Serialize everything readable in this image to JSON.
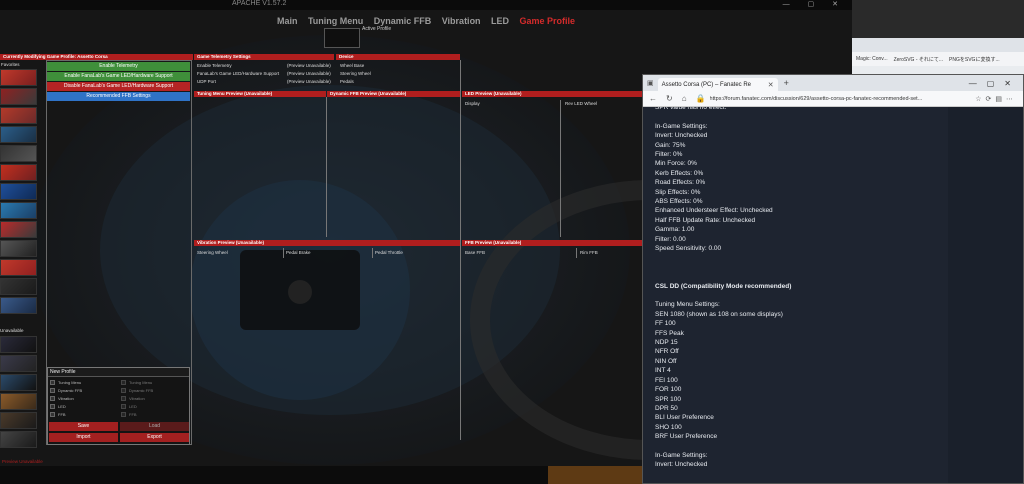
{
  "app": {
    "title": "APACHE V1.57.2",
    "window_controls": "— ▢ ✕",
    "nav": [
      {
        "label": "Main",
        "active": false
      },
      {
        "label": "Tuning Menu",
        "active": false
      },
      {
        "label": "Dynamic FFB",
        "active": false
      },
      {
        "label": "Vibration",
        "active": false
      },
      {
        "label": "LED",
        "active": false
      },
      {
        "label": "Game Profile",
        "active": true
      }
    ],
    "active_profile_label": "Active Profile",
    "left": {
      "header": "Currently Modifying Game Profile: Assetto Corsa",
      "favorites_label": "Favorites",
      "unavailable_label": "Unavailable",
      "buttons": [
        {
          "label": "Enable Telemetry",
          "color": "green"
        },
        {
          "label": "Enable FanaLab's Game LED/Hardware Support",
          "color": "green"
        },
        {
          "label": "Disable FanaLab's Game LED/Hardware Support",
          "color": "red"
        },
        {
          "label": "Recommended FFB Settings",
          "color": "blue"
        }
      ],
      "new_profile": {
        "title": "New Profile",
        "options_left": [
          "Tuning Menu",
          "Dynamic FFB",
          "Vibration",
          "LED",
          "FFB"
        ],
        "options_right": [
          "Tuning Menu",
          "Dynamic FFB",
          "Vibration",
          "LED",
          "FFB"
        ],
        "save": "Save",
        "load": "Load",
        "import": "Import",
        "export": "Export"
      }
    },
    "telemetry": {
      "header": "Game Telemetry Settings",
      "rows": [
        {
          "name": "Enable Telemetry",
          "value": "(Preview Unavailable)"
        },
        {
          "name": "FanaLab's Game LED/Hardware Support",
          "value": "(Preview Unavailable)"
        },
        {
          "name": "UDP Port",
          "value": "(Preview Unavailable)"
        }
      ]
    },
    "device": {
      "header": "Device",
      "rows": [
        "Wheel Base",
        "Steering Wheel",
        "Pedals"
      ]
    },
    "previews": {
      "tuning": "Tuning Menu Preview (Unavailable)",
      "dynamic": "Dynamic FFB Preview (Unavailable)",
      "led": "LED Preview (Unavailable)",
      "led_sub": [
        "Display",
        "Rev LED Wheel"
      ],
      "vibration": "Vibration Preview (Unavailable)",
      "vibration_sub": [
        "Steering Wheel",
        "Pedal Brake",
        "Pedal Throttle"
      ],
      "ffb": "FFB Preview (Unavailable)",
      "ffb_sub": [
        "Base FFB",
        "Rim FFB"
      ]
    },
    "bottom_status": "Preview Unavailable"
  },
  "browser": {
    "tab_title": "Assetto Corsa (PC) – Fanatec Re",
    "url": "https://forum.fanatec.com/discussion/629/assetto-corsa-pc-fanatec-recommended-set...",
    "post_lines": [
      {
        "text": "SPR value has no effect.",
        "bold": false
      },
      {
        "text": "",
        "bold": false
      },
      {
        "text": "In-Game Settings:",
        "bold": false
      },
      {
        "text": "Invert: Unchecked",
        "bold": false
      },
      {
        "text": "Gain: 75%",
        "bold": false
      },
      {
        "text": "Filter: 0%",
        "bold": false
      },
      {
        "text": "Min Force: 0%",
        "bold": false
      },
      {
        "text": "Kerb Effects: 0%",
        "bold": false
      },
      {
        "text": "Road Effects: 0%",
        "bold": false
      },
      {
        "text": "Slip Effects: 0%",
        "bold": false
      },
      {
        "text": "ABS Effects: 0%",
        "bold": false
      },
      {
        "text": "Enhanced Understeer Effect: Unchecked",
        "bold": false
      },
      {
        "text": "Half FFB Update Rate: Unchecked",
        "bold": false
      },
      {
        "text": "Gamma: 1.00",
        "bold": false
      },
      {
        "text": "Filter: 0.00",
        "bold": false
      },
      {
        "text": "Speed Sensitivity: 0.00",
        "bold": false
      },
      {
        "text": "",
        "bold": false
      },
      {
        "text": "",
        "bold": false
      },
      {
        "text": "",
        "bold": false
      },
      {
        "text": "CSL DD (Compatibility Mode recommended)",
        "bold": true
      },
      {
        "text": "",
        "bold": false
      },
      {
        "text": "Tuning Menu Settings:",
        "bold": false
      },
      {
        "text": "SEN 1080 (shown as 108 on some displays)",
        "bold": false
      },
      {
        "text": "FF 100",
        "bold": false
      },
      {
        "text": "FFS Peak",
        "bold": false
      },
      {
        "text": "NDP 15",
        "bold": false
      },
      {
        "text": "NFR Off",
        "bold": false
      },
      {
        "text": "NIN Off",
        "bold": false
      },
      {
        "text": "INT 4",
        "bold": false
      },
      {
        "text": "FEI 100",
        "bold": false
      },
      {
        "text": "FOR 100",
        "bold": false
      },
      {
        "text": "SPR 100",
        "bold": false
      },
      {
        "text": "DPR 50",
        "bold": false
      },
      {
        "text": "BLI User Preference",
        "bold": false
      },
      {
        "text": "SHO 100",
        "bold": false
      },
      {
        "text": "BRF User Preference",
        "bold": false
      },
      {
        "text": "",
        "bold": false
      },
      {
        "text": "In-Game Settings:",
        "bold": false
      },
      {
        "text": "Invert: Unchecked",
        "bold": false
      }
    ]
  },
  "bookmarks": [
    "Magic: Conv...",
    "ZeroSVG - それにて...",
    "PNGをSVGに変換す..."
  ]
}
